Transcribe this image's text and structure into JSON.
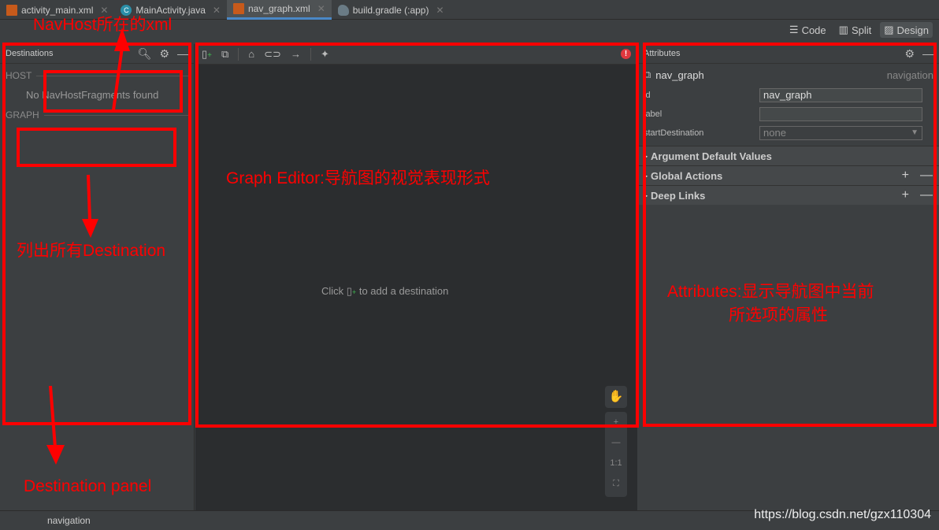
{
  "tabs": [
    {
      "label": "activity_main.xml",
      "icon": "xml-file-icon"
    },
    {
      "label": "MainActivity.java",
      "icon": "java-class-icon"
    },
    {
      "label": "nav_graph.xml",
      "icon": "xml-file-icon",
      "active": true
    },
    {
      "label": "build.gradle (:app)",
      "icon": "gradle-icon"
    }
  ],
  "modes": {
    "code": "Code",
    "split": "Split",
    "design": "Design",
    "selected": "Design"
  },
  "destinations": {
    "title": "Destinations",
    "host_label": "HOST",
    "host_empty": "No NavHostFragments found",
    "graph_label": "GRAPH"
  },
  "editor": {
    "hint_prefix": "Click",
    "hint_suffix": "to add a destination",
    "zoom_reset": "1:1"
  },
  "attributes": {
    "title": "Attributes",
    "name": "nav_graph",
    "type": "navigation",
    "id_label": "id",
    "id_value": "nav_graph",
    "label_label": "label",
    "label_value": "",
    "start_label": "startDestination",
    "start_value": "none",
    "sections": [
      "Argument Default Values",
      "Global Actions",
      "Deep Links"
    ]
  },
  "status": {
    "text": "navigation"
  },
  "annotations": {
    "navhost": "NavHost所在的xml",
    "graph_editor": "Graph Editor:导航图的视觉表现形式",
    "list": "列出所有Destination",
    "panel": "Destination panel",
    "attr1": "Attributes:显示导航图中当前",
    "attr2": "所选项的属性",
    "watermark": "https://blog.csdn.net/gzx110304"
  },
  "colors": {
    "annotation": "#ff0000",
    "tab_underline": "#4a88c7",
    "error": "#e0383e"
  }
}
